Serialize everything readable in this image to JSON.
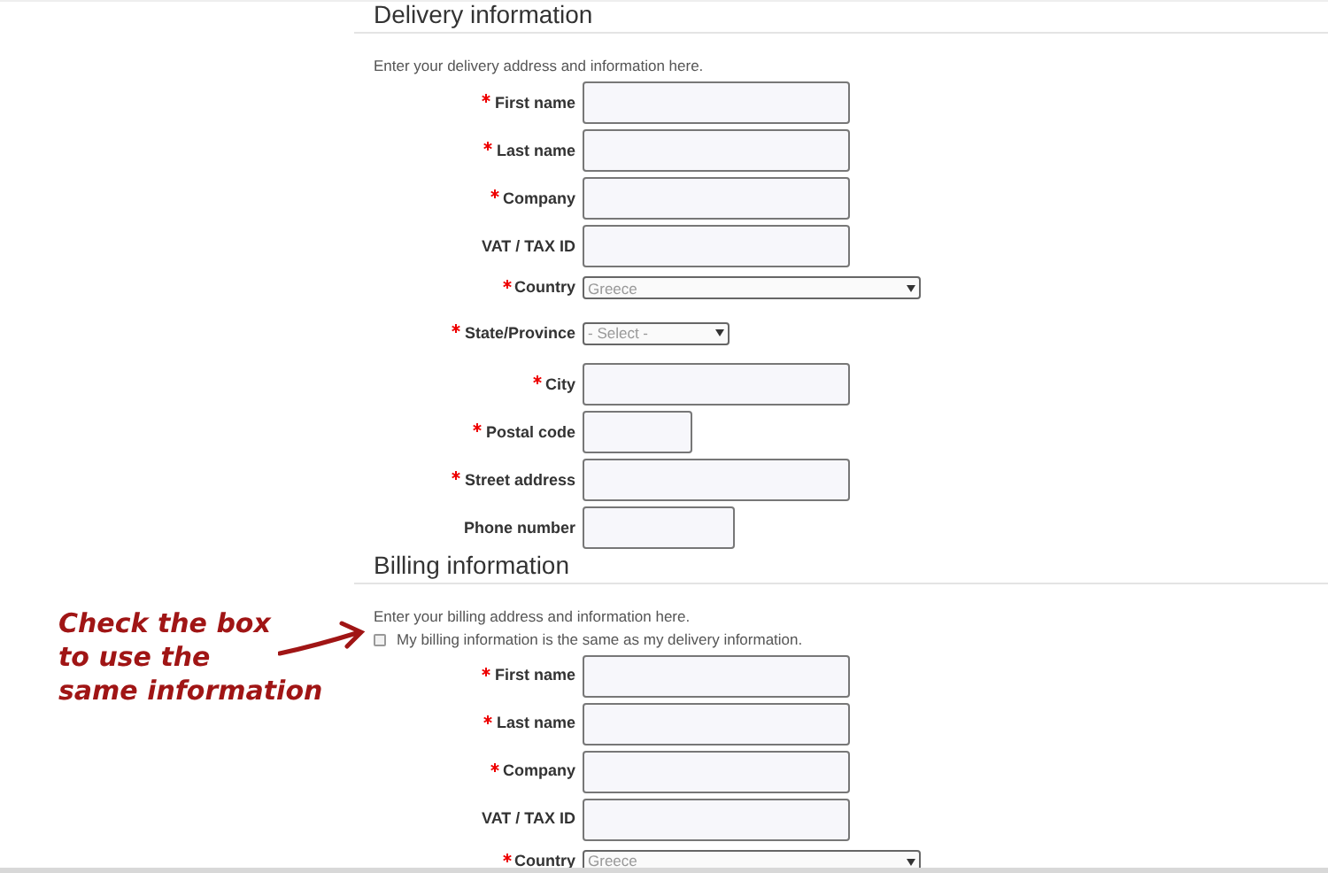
{
  "delivery": {
    "title": "Delivery information",
    "description": "Enter your delivery address and information here.",
    "fields": [
      {
        "kind": "text",
        "label": "First name",
        "required": true
      },
      {
        "kind": "text",
        "label": "Last name",
        "required": true
      },
      {
        "kind": "text",
        "label": "Company",
        "required": true
      },
      {
        "kind": "text",
        "label": "VAT / TAX ID",
        "required": false
      },
      {
        "kind": "select",
        "label": "Country",
        "required": true,
        "value": "Greece"
      },
      {
        "kind": "select",
        "label": "State/Province",
        "required": true,
        "value": "- Select -"
      },
      {
        "kind": "text",
        "label": "City",
        "required": true
      },
      {
        "kind": "text",
        "label": "Postal code",
        "required": true
      },
      {
        "kind": "text",
        "label": "Street address",
        "required": true
      },
      {
        "kind": "text",
        "label": "Phone number",
        "required": false
      }
    ]
  },
  "billing": {
    "title": "Billing information",
    "description": "Enter your billing address and information here.",
    "same_as_delivery": {
      "label": "My billing information is the same as my delivery information.",
      "checked": false
    },
    "fields": [
      {
        "kind": "text",
        "label": "First name",
        "required": true
      },
      {
        "kind": "text",
        "label": "Last name",
        "required": true
      },
      {
        "kind": "text",
        "label": "Company",
        "required": true
      },
      {
        "kind": "text",
        "label": "VAT / TAX ID",
        "required": false
      },
      {
        "kind": "select",
        "label": "Country",
        "required": true,
        "value": "Greece"
      }
    ]
  },
  "annotation": {
    "lines": [
      "Check the box",
      "to use the",
      "same information"
    ]
  }
}
